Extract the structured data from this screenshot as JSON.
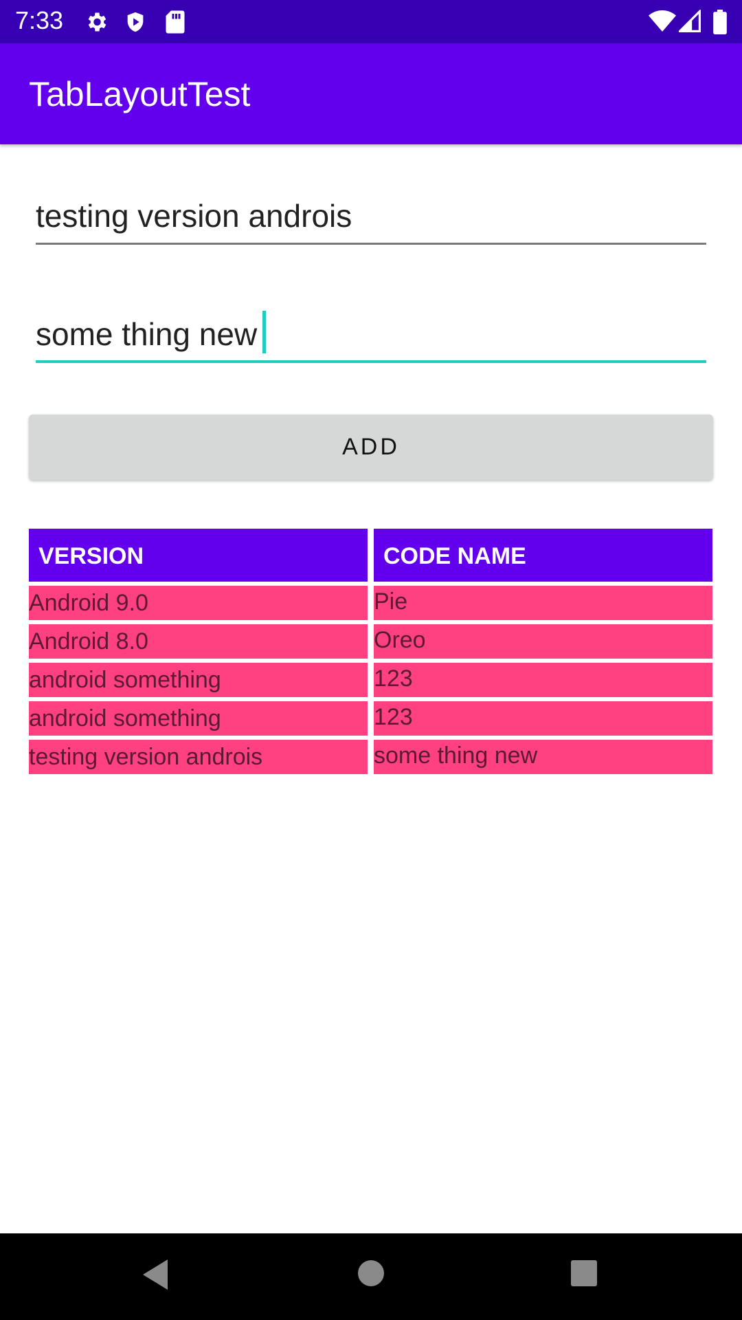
{
  "status_bar": {
    "time": "7:33",
    "icons_left": [
      "gear-icon",
      "shield-icon",
      "sd-card-icon"
    ],
    "icons_right": [
      "wifi-icon",
      "cell-signal-icon",
      "battery-icon"
    ]
  },
  "app_bar": {
    "title": "TabLayoutTest"
  },
  "form": {
    "version_value": "testing version androis",
    "codename_value": "some thing new",
    "add_label": "ADD"
  },
  "table": {
    "headers": [
      "VERSION",
      "CODE NAME"
    ],
    "rows": [
      [
        "Android 9.0",
        "Pie"
      ],
      [
        "Android 8.0",
        "Oreo"
      ],
      [
        "android something",
        "123"
      ],
      [
        "android something",
        "123"
      ],
      [
        "testing version androis",
        "some thing new"
      ]
    ]
  },
  "colors": {
    "status_bar": "#3700b3",
    "primary": "#6200ee",
    "accent": "#ff4081",
    "focus": "#1ccdc0"
  },
  "nav_bar": {
    "buttons": [
      "back-icon",
      "home-icon",
      "recents-icon"
    ]
  }
}
